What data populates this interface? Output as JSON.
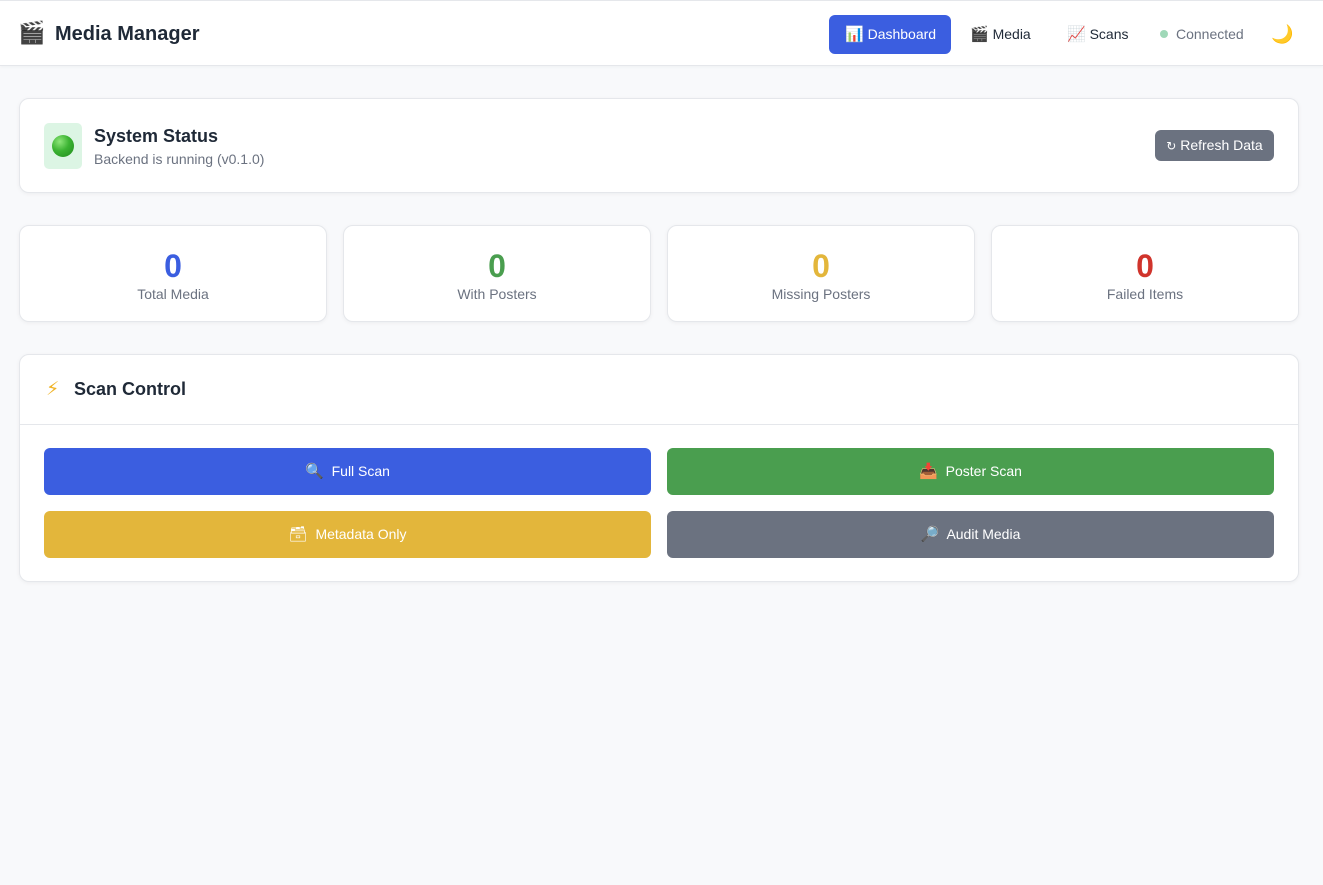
{
  "app": {
    "title": "Media Manager",
    "logo_icon": "clapperboard-icon",
    "logo_glyph": "🎬"
  },
  "nav": {
    "items": [
      {
        "label": "Dashboard",
        "icon": "bar-chart-icon",
        "glyph": "📊",
        "active": true
      },
      {
        "label": "Media",
        "icon": "clapperboard-icon",
        "glyph": "🎬",
        "active": false
      },
      {
        "label": "Scans",
        "icon": "trend-chart-icon",
        "glyph": "📈",
        "active": false
      }
    ],
    "connection_status": "Connected",
    "theme_toggle_icon": "moon-icon",
    "theme_toggle_glyph": "🌙"
  },
  "system_status": {
    "title": "System Status",
    "subtitle": "Backend is running (v0.1.0)",
    "indicator_icon": "green-circle-icon",
    "refresh_label": "Refresh Data",
    "refresh_glyph": "↻"
  },
  "stats": [
    {
      "value": "0",
      "label": "Total Media",
      "color": "#3b5ee0"
    },
    {
      "value": "0",
      "label": "With Posters",
      "color": "#4a9e4f"
    },
    {
      "value": "0",
      "label": "Missing Posters",
      "color": "#e3b63b"
    },
    {
      "value": "0",
      "label": "Failed Items",
      "color": "#d0342c"
    }
  ],
  "scan_control": {
    "title": "Scan Control",
    "icon": "lightning-icon",
    "glyph": "⚡",
    "buttons": [
      {
        "label": "Full Scan",
        "icon": "search-icon",
        "glyph": "🔍",
        "color": "#3b5ee0"
      },
      {
        "label": "Poster Scan",
        "icon": "inbox-tray-icon",
        "glyph": "📥",
        "color": "#4a9e4f"
      },
      {
        "label": "Metadata Only",
        "icon": "card-file-box-icon",
        "glyph": "🗃",
        "color": "#e3b63b"
      },
      {
        "label": "Audit Media",
        "icon": "magnifier-right-icon",
        "glyph": "🔎",
        "color": "#6b7280"
      }
    ]
  },
  "colors": {
    "accent": "#3b5ee0",
    "success": "#4a9e4f",
    "warning": "#e3b63b",
    "danger": "#d0342c",
    "neutral": "#6b7280"
  }
}
